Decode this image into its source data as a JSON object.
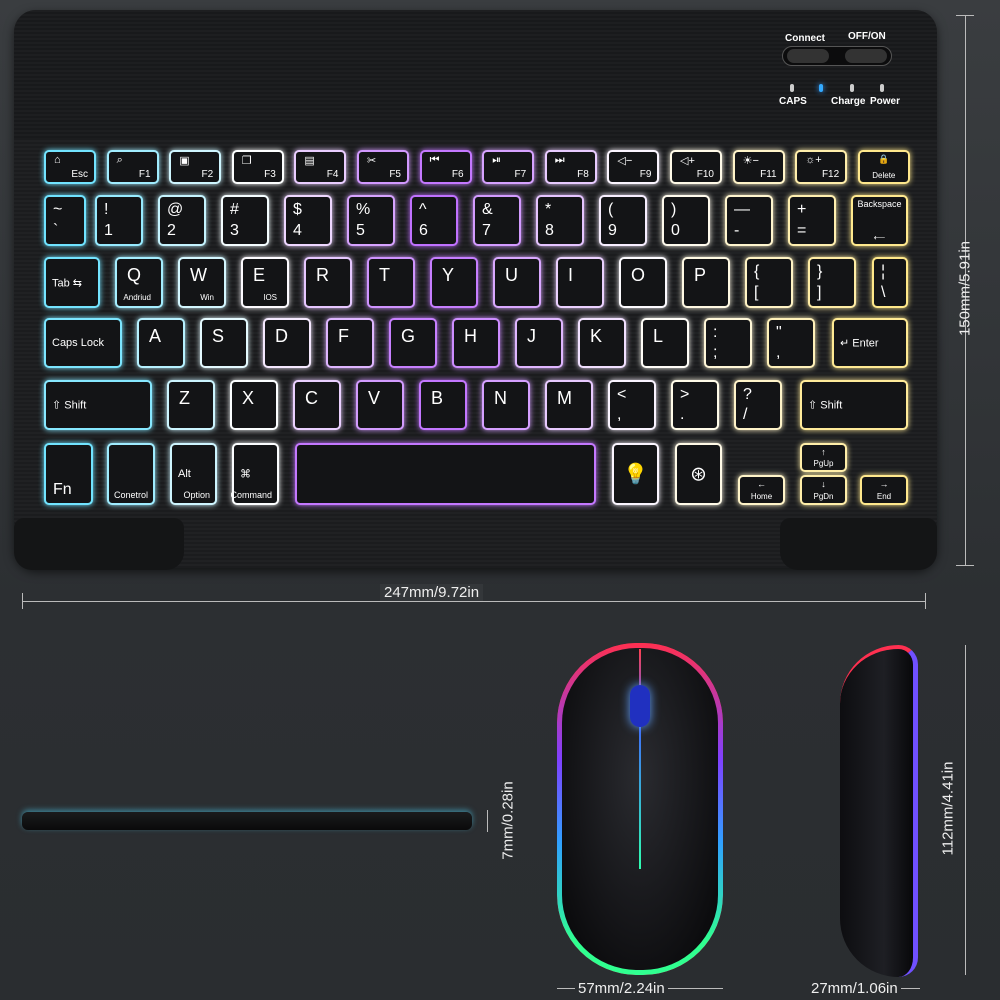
{
  "switch": {
    "connect": "Connect",
    "offon": "OFF/ON",
    "caps": "CAPS",
    "charge": "Charge",
    "power": "Power"
  },
  "dimensions": {
    "keyboard_width": "247mm/9.72in",
    "keyboard_height": "150mm/5.91in",
    "keyboard_thickness": "7mm/0.28in",
    "mouse_width": "57mm/2.24in",
    "mouse_length": "112mm/4.41in",
    "mouse_height": "27mm/1.06in"
  },
  "glow_colors": {
    "left": "#5fe0ff",
    "middle": "#c070ff",
    "right": "#ffe680",
    "neutral": "#ffffff"
  },
  "rows": [
    [
      {
        "kind": "fn",
        "icon": "home-icon",
        "b": "Esc"
      },
      {
        "kind": "fn",
        "icon": "search-icon",
        "b": "F1"
      },
      {
        "kind": "fn",
        "icon": "select-all-icon",
        "b": "F2"
      },
      {
        "kind": "fn",
        "icon": "copy-icon",
        "b": "F3"
      },
      {
        "kind": "fn",
        "icon": "paste-icon",
        "b": "F4"
      },
      {
        "kind": "fn",
        "icon": "cut-icon",
        "b": "F5"
      },
      {
        "kind": "fn",
        "icon": "previous-track-icon",
        "b": "F6"
      },
      {
        "kind": "fn",
        "icon": "play-pause-icon",
        "b": "F7"
      },
      {
        "kind": "fn",
        "icon": "next-track-icon",
        "b": "F8"
      },
      {
        "kind": "fn",
        "icon": "volume-down-icon",
        "b": "F9"
      },
      {
        "kind": "fn",
        "icon": "volume-up-icon",
        "b": "F10"
      },
      {
        "kind": "fn",
        "icon": "brightness-down-icon",
        "b": "F11"
      },
      {
        "kind": "fn",
        "icon": "brightness-up-icon",
        "b": "F12"
      },
      {
        "kind": "small",
        "icon": "lock-icon",
        "b": "Delete"
      }
    ],
    [
      {
        "t": "~",
        "b": "`"
      },
      {
        "t": "!",
        "b": "1"
      },
      {
        "t": "@",
        "b": "2"
      },
      {
        "t": "#",
        "b": "3"
      },
      {
        "t": "$",
        "b": "4"
      },
      {
        "t": "%",
        "b": "5"
      },
      {
        "t": "^",
        "b": "6"
      },
      {
        "t": "&",
        "b": "7"
      },
      {
        "t": "*",
        "b": "8"
      },
      {
        "t": "(",
        "b": "9"
      },
      {
        "t": ")",
        "b": "0"
      },
      {
        "t": "—",
        "b": "-"
      },
      {
        "t": "+",
        "b": "="
      },
      {
        "kind": "small",
        "t": "Backspace",
        "b": "⟵"
      }
    ],
    [
      {
        "kind": "mod",
        "t": "Tab ⇆"
      },
      {
        "kind": "letter",
        "t": "Q",
        "b": "Andriud"
      },
      {
        "kind": "letter",
        "t": "W",
        "b": "Win"
      },
      {
        "kind": "letter",
        "t": "E",
        "b": "IOS"
      },
      {
        "kind": "letter",
        "t": "R"
      },
      {
        "kind": "letter",
        "t": "T"
      },
      {
        "kind": "letter",
        "t": "Y"
      },
      {
        "kind": "letter",
        "t": "U"
      },
      {
        "kind": "letter",
        "t": "I"
      },
      {
        "kind": "letter",
        "t": "O"
      },
      {
        "kind": "letter",
        "t": "P"
      },
      {
        "t": "{",
        "b": "["
      },
      {
        "t": "}",
        "b": "]"
      },
      {
        "t": "¦",
        "b": "\\"
      }
    ],
    [
      {
        "kind": "mod",
        "t": "Caps Lock"
      },
      {
        "kind": "letter",
        "t": "A"
      },
      {
        "kind": "letter",
        "t": "S"
      },
      {
        "kind": "letter",
        "t": "D"
      },
      {
        "kind": "letter",
        "t": "F"
      },
      {
        "kind": "letter",
        "t": "G"
      },
      {
        "kind": "letter",
        "t": "H"
      },
      {
        "kind": "letter",
        "t": "J"
      },
      {
        "kind": "letter",
        "t": "K"
      },
      {
        "kind": "letter",
        "t": "L"
      },
      {
        "t": ":",
        "b": ";"
      },
      {
        "t": "\"",
        "b": ","
      },
      {
        "kind": "mod",
        "t": "↵ Enter"
      }
    ],
    [
      {
        "kind": "mod",
        "t": "⇧ Shift"
      },
      {
        "kind": "letter",
        "t": "Z"
      },
      {
        "kind": "letter",
        "t": "X"
      },
      {
        "kind": "letter",
        "t": "C"
      },
      {
        "kind": "letter",
        "t": "V"
      },
      {
        "kind": "letter",
        "t": "B"
      },
      {
        "kind": "letter",
        "t": "N"
      },
      {
        "kind": "letter",
        "t": "M"
      },
      {
        "t": "<",
        "b": ","
      },
      {
        "t": ">",
        "b": "."
      },
      {
        "t": "?",
        "b": "/"
      },
      {
        "kind": "mod",
        "t": "⇧ Shift"
      }
    ],
    [
      {
        "t": "",
        "b": "Fn"
      },
      {
        "kind": "mod",
        "b": "Conetrol"
      },
      {
        "kind": "mod",
        "t": "Alt",
        "b": "Option"
      },
      {
        "kind": "mod",
        "t": "⌘",
        "b": "Command"
      },
      {
        "kind": "space"
      },
      {
        "kind": "icon",
        "icon": "backlight-bulb-icon"
      },
      {
        "kind": "icon",
        "icon": "rgb-color-icon"
      },
      {
        "kind": "small",
        "t": "←",
        "b": "Home"
      },
      {
        "kind": "small",
        "t": "↑",
        "b": "PgUp"
      },
      {
        "kind": "small",
        "t": "↓",
        "b": "PgDn"
      },
      {
        "kind": "small",
        "t": "→",
        "b": "End"
      }
    ]
  ]
}
